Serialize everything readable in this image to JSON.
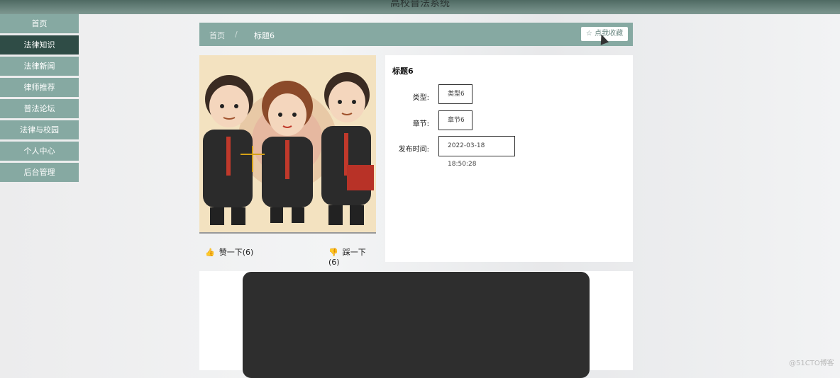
{
  "app_title": "高校普法系统",
  "sidebar": {
    "items": [
      {
        "label": "首页"
      },
      {
        "label": "法律知识"
      },
      {
        "label": "法律新闻"
      },
      {
        "label": "律师推荐"
      },
      {
        "label": "普法论坛"
      },
      {
        "label": "法律与校园"
      },
      {
        "label": "个人中心"
      },
      {
        "label": "后台管理"
      }
    ],
    "active_index": 1
  },
  "breadcrumb": {
    "home": "首页",
    "separator": "/",
    "current": "标题6"
  },
  "favorite_button": "☆ 点我收藏",
  "detail": {
    "title": "标题6",
    "fields": [
      {
        "label": "类型:",
        "value": "类型6"
      },
      {
        "label": "章节:",
        "value": "章节6"
      },
      {
        "label": "发布时间:",
        "value": "2022-03-18 18:50:28"
      }
    ]
  },
  "votes": {
    "like": "赞一下(6)",
    "dislike": "踩一下(6)"
  },
  "watermark": "@51CTO博客",
  "colors": {
    "primary": "#86a9a2",
    "active": "#2f4c46",
    "vote_icon": "#d83a2a"
  }
}
